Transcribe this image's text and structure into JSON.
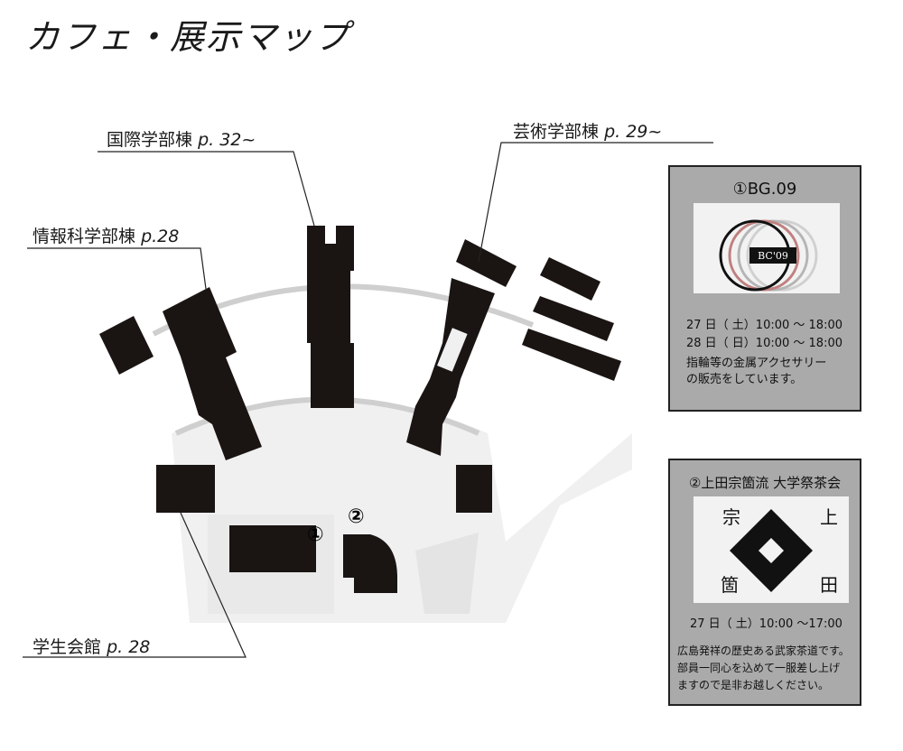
{
  "title": "カフェ・展示マップ",
  "labels": {
    "kokusai": {
      "name": "国際学部棟",
      "page": "p. 32~"
    },
    "geijutsu": {
      "name": "芸術学部棟",
      "page": "p. 29~"
    },
    "joho": {
      "name": "情報科学部棟",
      "page": "p.28"
    },
    "gakusei": {
      "name": "学生会館",
      "page": "p. 28"
    }
  },
  "markers": {
    "one": "①",
    "two": "②"
  },
  "panel1": {
    "title": "①BG.09",
    "logo_text": "BC'09",
    "lines": [
      "27 日（ 土）10:00 〜 18:00",
      "28 日（ 日）10:00 〜 18:00",
      "指輪等の金属アクセサリー",
      "の販売をしています。"
    ]
  },
  "panel2": {
    "title": "②上田宗箇流 大学祭茶会",
    "crest_chars": [
      "宗",
      "上",
      "箇",
      "田"
    ],
    "lines": [
      "27 日（ 土）10:00 〜17:00",
      "広島発祥の歴史ある武家茶道です。",
      "部員一同心を込めて一服差し上げ",
      "ますので是非お越しください。"
    ]
  },
  "colors": {
    "building": "#1a1413",
    "panel": "#aaaaaa",
    "ground": "#efefef"
  }
}
